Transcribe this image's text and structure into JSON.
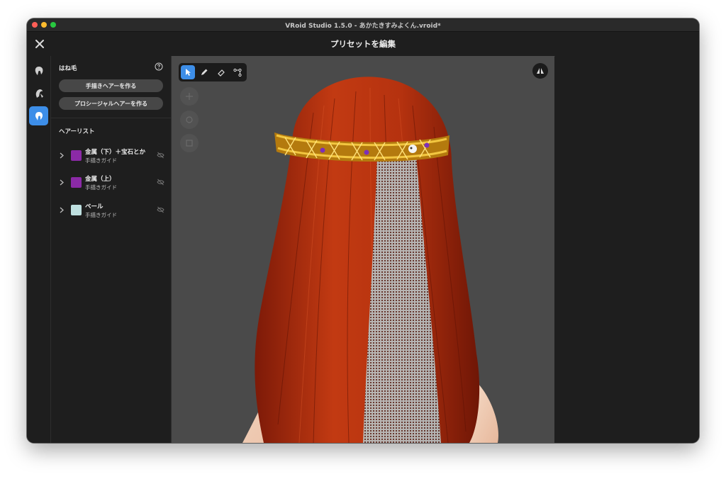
{
  "window": {
    "title": "VRoid Studio 1.5.0 - あかたきすみよくん.vroid*"
  },
  "header": {
    "title": "プリセットを編集"
  },
  "sidebar_rail": {
    "items": [
      {
        "icon": "hair-icon",
        "active": false
      },
      {
        "icon": "hair-cut-icon",
        "active": false
      },
      {
        "icon": "hair-strand-icon",
        "active": true
      }
    ]
  },
  "panel": {
    "title": "はね毛",
    "buttons": {
      "handdrawn": "手描きヘアーを作る",
      "procedural": "プロシージャルヘアーを作る"
    },
    "list_title": "ヘアーリスト",
    "hair_list": [
      {
        "name": "金属（下）＋宝石とか",
        "type": "手描きガイド",
        "color": "#8b2aa6"
      },
      {
        "name": "金属（上）",
        "type": "手描きガイド",
        "color": "#8b2aa6"
      },
      {
        "name": "ベール",
        "type": "手描きガイド",
        "color": "#bfe0e0"
      }
    ]
  },
  "viewport": {
    "tools": [
      {
        "icon": "select-cursor-icon",
        "active": true
      },
      {
        "icon": "pen-icon",
        "active": false
      },
      {
        "icon": "eraser-icon",
        "active": false
      },
      {
        "icon": "curve-edit-icon",
        "active": false
      }
    ],
    "nav_controls": [
      "move-icon",
      "rotate-icon",
      "zoom-icon"
    ],
    "mirror_icon": "mirror-icon"
  },
  "colors": {
    "accent": "#3d8ee8",
    "background": "#1e1e1e",
    "viewport": "#4a4a4a",
    "hair": "#b8320f",
    "veil": "#bfe0e0"
  }
}
